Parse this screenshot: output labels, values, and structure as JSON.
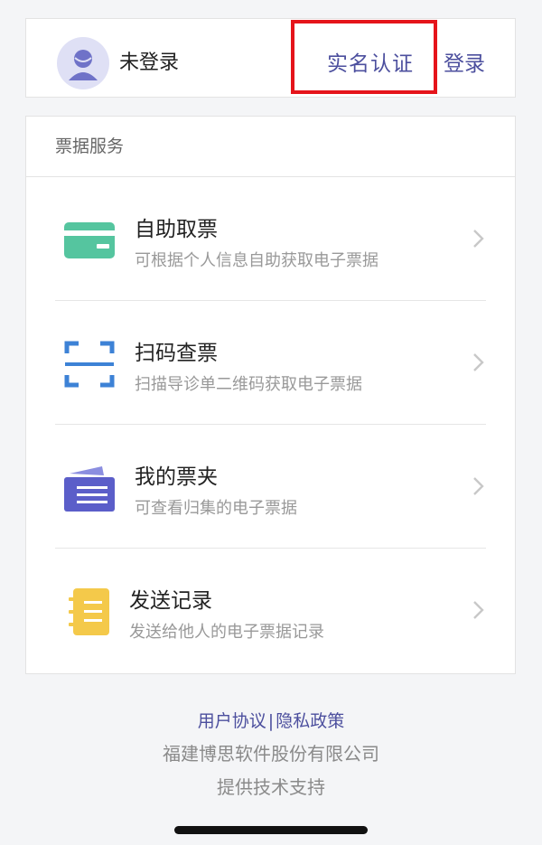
{
  "header": {
    "user_status": "未登录",
    "verify_label": "实名认证",
    "login_label": "登录",
    "avatar_icon": "user-avatar-icon"
  },
  "services": {
    "section_title": "票据服务",
    "items": [
      {
        "title": "自助取票",
        "desc": "可根据个人信息自助获取电子票据",
        "icon": "ticket-card-icon",
        "color": "#55c59f"
      },
      {
        "title": "扫码查票",
        "desc": "扫描导诊单二维码获取电子票据",
        "icon": "scan-frame-icon",
        "color": "#3d82d6"
      },
      {
        "title": "我的票夹",
        "desc": "可查看归集的电子票据",
        "icon": "ticket-folder-icon",
        "color": "#5b5ec9"
      },
      {
        "title": "发送记录",
        "desc": "发送给他人的电子票据记录",
        "icon": "notebook-icon",
        "color": "#f4c94a"
      }
    ]
  },
  "footer": {
    "user_agreement": "用户协议",
    "separator": "|",
    "privacy_policy": "隐私政策",
    "company": "福建博思软件股份有限公司",
    "support": "提供技术支持"
  },
  "colors": {
    "accent": "#4c4f9e",
    "highlight": "#e5141b",
    "background": "#f4f5f7"
  }
}
